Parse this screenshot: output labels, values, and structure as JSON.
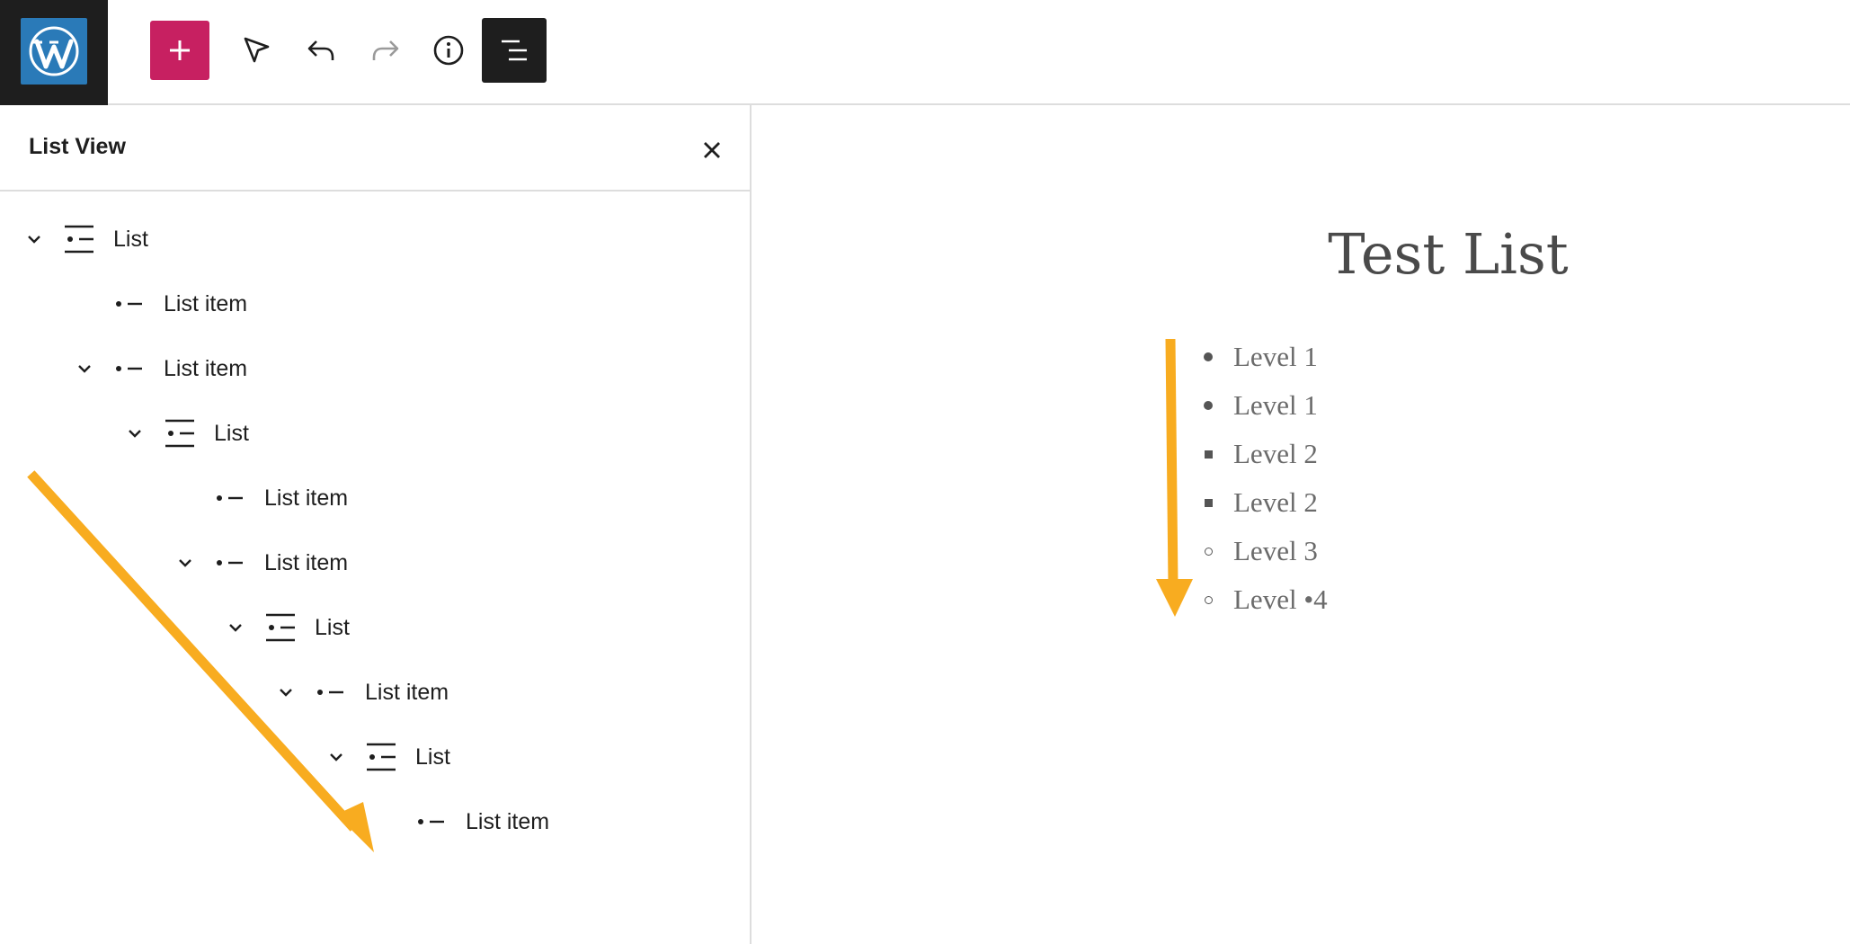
{
  "toolbar": {
    "logo_icon": "wordpress-logo-icon",
    "inserter_icon": "plus-icon",
    "select_icon": "pointer-icon",
    "undo_icon": "undo-icon",
    "redo_icon": "redo-icon",
    "info_icon": "info-icon",
    "listview_icon": "list-view-icon",
    "inserter_color": "#c72061"
  },
  "sidebar": {
    "title": "List View",
    "close_icon": "close-icon",
    "rows": [
      {
        "label": "List",
        "type": "list",
        "depth": 0,
        "expanded": true
      },
      {
        "label": "List item",
        "type": "list-item",
        "depth": 1,
        "expanded": false
      },
      {
        "label": "List item",
        "type": "list-item",
        "depth": 1,
        "expanded": true
      },
      {
        "label": "List",
        "type": "list",
        "depth": 2,
        "expanded": true
      },
      {
        "label": "List item",
        "type": "list-item",
        "depth": 3,
        "expanded": false
      },
      {
        "label": "List item",
        "type": "list-item",
        "depth": 3,
        "expanded": true
      },
      {
        "label": "List",
        "type": "list",
        "depth": 4,
        "expanded": true
      },
      {
        "label": "List item",
        "type": "list-item",
        "depth": 5,
        "expanded": true
      },
      {
        "label": "List",
        "type": "list",
        "depth": 6,
        "expanded": true
      },
      {
        "label": "List item",
        "type": "list-item",
        "depth": 7,
        "expanded": false
      }
    ]
  },
  "canvas": {
    "title": "Test List",
    "items": [
      {
        "text": "Level 1",
        "bullet": "disc"
      },
      {
        "text": "Level 1",
        "bullet": "disc"
      },
      {
        "text": "Level 2",
        "bullet": "square"
      },
      {
        "text": "Level 2",
        "bullet": "square"
      },
      {
        "text": "Level 3",
        "bullet": "circle"
      },
      {
        "text": "Level •4",
        "bullet": "circle"
      }
    ]
  },
  "annotations": {
    "arrow_color": "#f8ac20"
  }
}
